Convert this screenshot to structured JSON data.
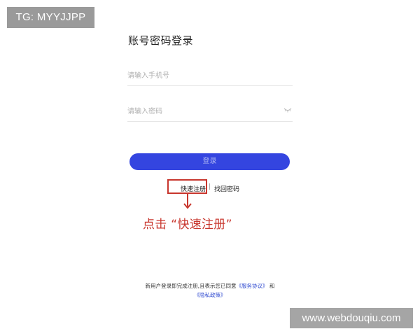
{
  "overlay": {
    "tg_badge": "TG: MYYJJPP",
    "watermark": "www.webdouqiu.com"
  },
  "login": {
    "title": "账号密码登录",
    "phone_placeholder": "请输入手机号",
    "password_placeholder": "请输入密码",
    "login_button": "登录",
    "quick_register": "快速注册",
    "separator": "|",
    "find_password": "找回密码"
  },
  "annotation": {
    "text": "点击 “快速注册”",
    "color": "#c8362d"
  },
  "terms": {
    "line1_prefix": "新用户登录即完成注册,且表示您已同意",
    "service_agreement": "《服务协议》",
    "and": "和",
    "privacy_policy": "《隐私政策》"
  },
  "colors": {
    "primary_button": "#3445e0",
    "link": "#2f4ad0"
  },
  "icons": {
    "password_toggle": "eye-closed-icon",
    "annotation_arrow": "arrow-down-icon"
  }
}
